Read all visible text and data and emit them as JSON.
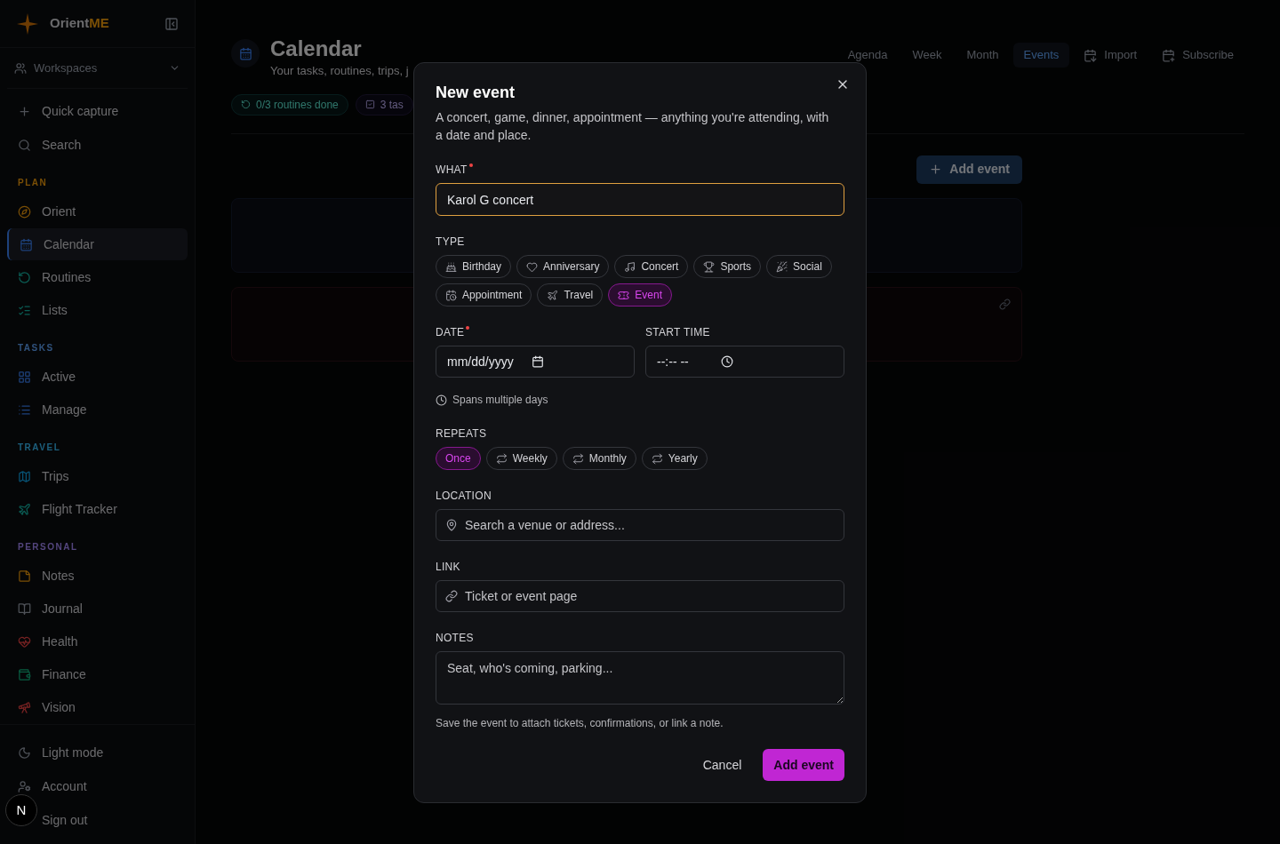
{
  "sidebar": {
    "brand": {
      "name": "Orient",
      "accent": "ME"
    },
    "workspaces": "Workspaces",
    "actions": [
      "Quick capture",
      "Search"
    ],
    "sections": [
      {
        "label": "PLAN",
        "items": [
          {
            "label": "Orient",
            "selected": false
          },
          {
            "label": "Calendar",
            "selected": true
          },
          {
            "label": "Routines",
            "selected": false
          },
          {
            "label": "Lists",
            "selected": false
          }
        ]
      },
      {
        "label": "TASKS",
        "items": [
          {
            "label": "Active",
            "selected": false
          },
          {
            "label": "Manage",
            "selected": false
          }
        ]
      },
      {
        "label": "TRAVEL",
        "items": [
          {
            "label": "Trips",
            "selected": false
          },
          {
            "label": "Flight Tracker",
            "selected": false
          }
        ]
      },
      {
        "label": "PERSONAL",
        "items": [
          {
            "label": "Notes",
            "selected": false
          },
          {
            "label": "Journal",
            "selected": false
          },
          {
            "label": "Health",
            "selected": false
          },
          {
            "label": "Finance",
            "selected": false
          },
          {
            "label": "Vision",
            "selected": false
          }
        ]
      }
    ],
    "footer": [
      "Light mode",
      "Account",
      "Sign out"
    ]
  },
  "dev_badge": "N",
  "page": {
    "title": "Calendar",
    "subtitle": "Your tasks, routines, trips, j",
    "stats": [
      "0/3 routines done",
      "3 tas"
    ],
    "views": [
      {
        "label": "Agenda",
        "selected": false
      },
      {
        "label": "Week",
        "selected": false
      },
      {
        "label": "Month",
        "selected": false
      },
      {
        "label": "Events",
        "selected": true
      }
    ],
    "tools": [
      "Import",
      "Subscribe"
    ],
    "add_button": "Add event"
  },
  "dialog": {
    "title": "New event",
    "description": "A concert, game, dinner, appointment — anything you're attending, with a date and place.",
    "what": {
      "label": "WHAT",
      "required": true,
      "value": "Karol G concert"
    },
    "type": {
      "label": "TYPE",
      "options": [
        {
          "label": "Birthday",
          "selected": false
        },
        {
          "label": "Anniversary",
          "selected": false
        },
        {
          "label": "Concert",
          "selected": false
        },
        {
          "label": "Sports",
          "selected": false
        },
        {
          "label": "Social",
          "selected": false
        },
        {
          "label": "Appointment",
          "selected": false
        },
        {
          "label": "Travel",
          "selected": false
        },
        {
          "label": "Event",
          "selected": true
        }
      ]
    },
    "date": {
      "label": "DATE",
      "required": true,
      "placeholder": "mm/dd/yyyy"
    },
    "start_time": {
      "label": "START TIME",
      "required": false,
      "placeholder": "--:-- --"
    },
    "multi_day": "Spans multiple days",
    "repeats": {
      "label": "REPEATS",
      "options": [
        {
          "label": "Once",
          "selected": true
        },
        {
          "label": "Weekly",
          "selected": false
        },
        {
          "label": "Monthly",
          "selected": false
        },
        {
          "label": "Yearly",
          "selected": false
        }
      ]
    },
    "location": {
      "label": "LOCATION",
      "placeholder": "Search a venue or address..."
    },
    "link": {
      "label": "LINK",
      "placeholder": "Ticket or event page"
    },
    "notes": {
      "label": "NOTES",
      "placeholder": "Seat, who's coming, parking..."
    },
    "hint": "Save the event to attach tickets, confirmations, or link a note.",
    "buttons": {
      "cancel": "Cancel",
      "submit": "Add event"
    }
  }
}
